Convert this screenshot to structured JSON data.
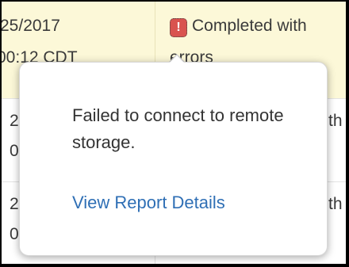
{
  "rows": [
    {
      "date_line1": "25/2017",
      "date_line2": "00:12 CDT",
      "status_line1": "Completed with",
      "status_line2": "errors",
      "status_icon": "exclamation-icon"
    },
    {
      "date_line1": "2",
      "date_line2": "0",
      "status_line1": "th",
      "status_line2": ""
    },
    {
      "date_line1": "2",
      "date_line2": "0",
      "status_line1": "th",
      "status_line2": ""
    }
  ],
  "popover": {
    "message": "Failed to connect to remote storage.",
    "link_label": "View Report Details"
  },
  "colors": {
    "error": "#d9534f",
    "link": "#2f6fb5",
    "highlight_row": "#fcf8d8"
  }
}
